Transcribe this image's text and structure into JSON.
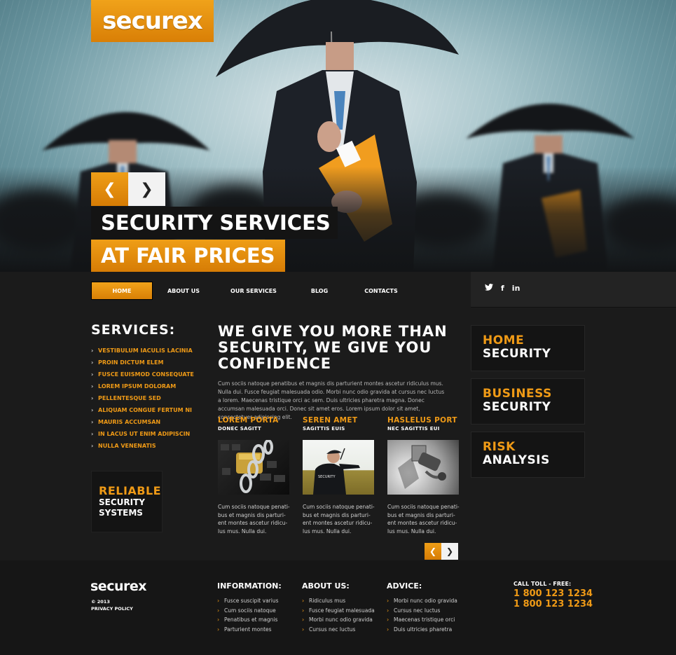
{
  "brand": {
    "logo": "securex",
    "accent_color": "#ef9a16",
    "background_color": "#1b1b1b"
  },
  "hero": {
    "title_line1": "SECURITY SERVICES",
    "title_line2": "AT FAIR PRICES",
    "prev_icon": "❮",
    "next_icon": "❯"
  },
  "nav": {
    "items": [
      {
        "label": "HOME",
        "active": true
      },
      {
        "label": "ABOUT US",
        "active": false
      },
      {
        "label": "OUR SERVICES",
        "active": false
      },
      {
        "label": "BLOG",
        "active": false
      },
      {
        "label": "CONTACTS",
        "active": false
      }
    ],
    "social": {
      "twitter": "🐦",
      "facebook": "f",
      "linkedin": "in"
    }
  },
  "services": {
    "title": "SERVICES:",
    "items": [
      "VESTIBULUM IACULIS LACINIA",
      "PROIN DICTUM ELEM",
      "FUSCE EUISMOD CONSEQUATE",
      "LOREM IPSUM DOLORAM",
      "PELLENTESQUE SED",
      "ALIQUAM CONGUE FERTUM NI",
      "MAURIS ACCUMSAN",
      "IN LACUS UT ENIM ADIPISCIN",
      "NULLA VENENATIS"
    ],
    "bullet": "›"
  },
  "reliable": {
    "line1": "RELIABLE",
    "line2": "SECURITY",
    "line3": "SYSTEMS"
  },
  "main": {
    "heading": "WE GIVE YOU MORE THAN SECURITY, WE GIVE YOU CONFIDENCE",
    "paragraph": "Cum sociis natoque penatibus et magnis dis parturient montes ascetur ridiculus mus. Nulla dui. Fusce feugiat malesuada odio. Morbi nunc odio gravida at cursus nec luctus a lorem. Maecenas tristique orci ac sem. Duis ultricies pharetra magna. Donec accumsan malesuada orci. Donec sit amet eros. Lorem ipsum dolor sit amet, consectetuer adipiscing elit.",
    "cards": [
      {
        "title": "LOREM PORTA",
        "subtitle": "DONEC SAGITT",
        "image": "padlock-chain-keyboard",
        "text": "Cum sociis natoque penati-bus et magnis dis parturi-ent montes ascetur ridicu-lus mus. Nulla dui."
      },
      {
        "title": "SEREN AMET",
        "subtitle": "SAGITTIS EUIS",
        "image": "security-guard-radio",
        "text": "Cum sociis natoque penati-bus et magnis dis parturi-ent montes ascetur ridicu-lus mus. Nulla dui."
      },
      {
        "title": "HASLELUS PORT",
        "subtitle": "NEC SAGITTIS EUI",
        "image": "cctv-camera",
        "text": "Cum sociis natoque penati-bus et magnis dis parturi-ent montes ascetur ridicu-lus mus. Nulla dui."
      }
    ],
    "pager": {
      "prev_icon": "❮",
      "next_icon": "❯"
    }
  },
  "right_boxes": [
    {
      "line1": "HOME",
      "line2": "SECURITY"
    },
    {
      "line1": "BUSINESS",
      "line2": "SECURITY"
    },
    {
      "line1": "RISK",
      "line2": "ANALYSIS"
    }
  ],
  "footer": {
    "logo": "securex",
    "copyright": "© 2013",
    "privacy": "PRIVACY POLICY",
    "columns": [
      {
        "title": "INFORMATION:",
        "items": [
          "Fusce suscipit varius",
          "Cum sociis natoque",
          "Penatibus et magnis",
          "Parturient montes"
        ]
      },
      {
        "title": "ABOUT US:",
        "items": [
          "Ridiculus mus",
          "Fusce feugiat malesuada",
          "Morbi nunc odio gravida",
          "Cursus nec luctus"
        ]
      },
      {
        "title": "ADVICE:",
        "items": [
          "Morbi nunc odio gravida",
          "Cursus nec luctus",
          "Maecenas tristique orci",
          "Duis ultricies pharetra"
        ]
      }
    ],
    "call_label": "CALL TOLL - FREE:",
    "phones": [
      "1 800 123 1234",
      "1 800 123 1234"
    ]
  }
}
